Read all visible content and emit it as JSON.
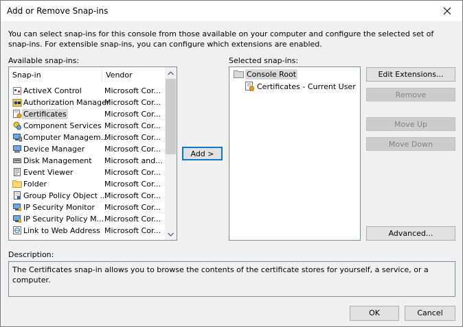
{
  "window": {
    "title": "Add or Remove Snap-ins"
  },
  "intro_text": "You can select snap-ins for this console from those available on your computer and configure the selected set of snap-ins. For extensible snap-ins, you can configure which extensions are enabled.",
  "available": {
    "label": "Available snap-ins:",
    "columns": {
      "name": "Snap-in",
      "vendor": "Vendor"
    },
    "items": [
      {
        "name": "ActiveX Control",
        "vendor": "Microsoft Cor...",
        "icon": "activex-icon"
      },
      {
        "name": "Authorization Manager",
        "vendor": "Microsoft Cor...",
        "icon": "authorization-icon"
      },
      {
        "name": "Certificates",
        "vendor": "Microsoft Cor...",
        "icon": "certificate-icon"
      },
      {
        "name": "Component Services",
        "vendor": "Microsoft Cor...",
        "icon": "component-services-icon"
      },
      {
        "name": "Computer Managem...",
        "vendor": "Microsoft Cor...",
        "icon": "computer-management-icon"
      },
      {
        "name": "Device Manager",
        "vendor": "Microsoft Cor...",
        "icon": "device-manager-icon"
      },
      {
        "name": "Disk Management",
        "vendor": "Microsoft and...",
        "icon": "disk-icon"
      },
      {
        "name": "Event Viewer",
        "vendor": "Microsoft Cor...",
        "icon": "event-viewer-icon"
      },
      {
        "name": "Folder",
        "vendor": "Microsoft Cor...",
        "icon": "folder-icon"
      },
      {
        "name": "Group Policy Object ...",
        "vendor": "Microsoft Cor...",
        "icon": "group-policy-icon"
      },
      {
        "name": "IP Security Monitor",
        "vendor": "Microsoft Cor...",
        "icon": "ip-security-icon"
      },
      {
        "name": "IP Security Policy M...",
        "vendor": "Microsoft Cor...",
        "icon": "ip-security-policy-icon"
      },
      {
        "name": "Link to Web Address",
        "vendor": "Microsoft Cor...",
        "icon": "link-icon"
      }
    ],
    "selected_index": 2
  },
  "add_button": "Add >",
  "selected": {
    "label": "Selected snap-ins:",
    "root": "Console Root",
    "child": "Certificates - Current User"
  },
  "buttons": {
    "edit_extensions": "Edit Extensions...",
    "remove": "Remove",
    "move_up": "Move Up",
    "move_down": "Move Down",
    "advanced": "Advanced...",
    "ok": "OK",
    "cancel": "Cancel"
  },
  "description": {
    "label": "Description:",
    "text": "The Certificates snap-in allows you to browse the contents of the certificate stores for yourself, a service, or a computer."
  }
}
